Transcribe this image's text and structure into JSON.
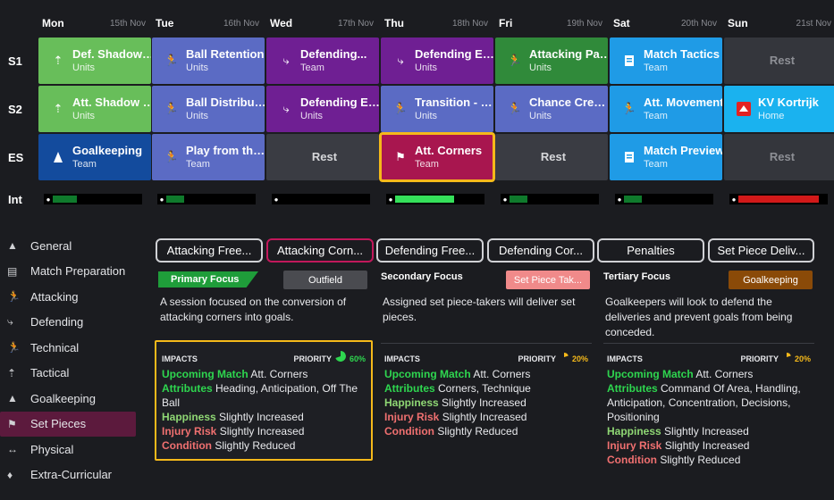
{
  "days": [
    {
      "name": "Mon",
      "date": "15th Nov"
    },
    {
      "name": "Tue",
      "date": "16th Nov"
    },
    {
      "name": "Wed",
      "date": "17th Nov"
    },
    {
      "name": "Thu",
      "date": "18th Nov"
    },
    {
      "name": "Fri",
      "date": "19th Nov"
    },
    {
      "name": "Sat",
      "date": "20th Nov"
    },
    {
      "name": "Sun",
      "date": "21st Nov"
    }
  ],
  "rows": [
    {
      "label": "S1",
      "cells": [
        {
          "title": "Def. Shadow Play",
          "sub": "Units",
          "color": "#68be5a",
          "icon": "tactical-icon"
        },
        {
          "title": "Ball Retention",
          "sub": "Units",
          "color": "#5b6bc4",
          "icon": "technical-icon"
        },
        {
          "title": "Defending...",
          "sub": "Team",
          "color": "#6f1f93",
          "icon": "defending-icon"
        },
        {
          "title": "Defending Engaged",
          "sub": "Units",
          "color": "#6f1f93",
          "icon": "defending-icon"
        },
        {
          "title": "Attacking Patient",
          "sub": "Units",
          "color": "#308a3a",
          "icon": "attacking-icon"
        },
        {
          "title": "Match Tactics",
          "sub": "Team",
          "color": "#1f9be6",
          "icon": "match-prep-icon"
        },
        {
          "title": "Rest",
          "sub": "",
          "color": "#34363c",
          "icon": ""
        }
      ]
    },
    {
      "label": "S2",
      "cells": [
        {
          "title": "Att. Shadow Play",
          "sub": "Units",
          "color": "#68be5a",
          "icon": "tactical-icon"
        },
        {
          "title": "Ball Distribution",
          "sub": "Units",
          "color": "#5b6bc4",
          "icon": "technical-icon"
        },
        {
          "title": "Defending Engaged",
          "sub": "Units",
          "color": "#6f1f93",
          "icon": "defending-icon"
        },
        {
          "title": "Transition - Press",
          "sub": "Units",
          "color": "#5b6bc4",
          "icon": "technical-icon"
        },
        {
          "title": "Chance Creation",
          "sub": "Units",
          "color": "#5b6bc4",
          "icon": "attacking-icon"
        },
        {
          "title": "Att. Movement",
          "sub": "Team",
          "color": "#1f9be6",
          "icon": "attacking-icon"
        },
        {
          "title": "KV Kortrijk",
          "sub": "Home",
          "color": "#1ab2ef",
          "icon": "club-badge-icon"
        }
      ]
    },
    {
      "label": "ES",
      "cells": [
        {
          "title": "Goalkeeping",
          "sub": "Team",
          "color": "#134b9d",
          "icon": "goalkeeping-icon"
        },
        {
          "title": "Play from the Back",
          "sub": "Team",
          "color": "#5b6bc4",
          "icon": "technical-icon"
        },
        {
          "title": "Rest",
          "sub": "",
          "color": "#3a3c43",
          "icon": ""
        },
        {
          "title": "Att. Corners",
          "sub": "Team",
          "color": "#a8164f",
          "icon": "set-pieces-icon"
        },
        {
          "title": "Rest",
          "sub": "",
          "color": "#3a3c43",
          "icon": ""
        },
        {
          "title": "Match Preview",
          "sub": "Team",
          "color": "#1f9be6",
          "icon": "match-prep-icon"
        },
        {
          "title": "Rest",
          "sub": "",
          "color": "#34363c",
          "icon": ""
        }
      ]
    }
  ],
  "intensity": {
    "label": "Int",
    "levels": [
      0.27,
      0.2,
      0,
      0.66,
      0.2,
      0.2,
      0.9
    ],
    "colors": [
      "#0f7a2c",
      "#0f7a2c",
      "#0f7a2c",
      "#35e05a",
      "#0f7a2c",
      "#0f7a2c",
      "#d21919"
    ]
  },
  "sidebar": [
    {
      "label": "General",
      "icon": "general-icon"
    },
    {
      "label": "Match Preparation",
      "icon": "match-prep-icon"
    },
    {
      "label": "Attacking",
      "icon": "attacking-icon"
    },
    {
      "label": "Defending",
      "icon": "defending-icon"
    },
    {
      "label": "Technical",
      "icon": "technical-icon"
    },
    {
      "label": "Tactical",
      "icon": "tactical-icon"
    },
    {
      "label": "Goalkeeping",
      "icon": "goalkeeping-icon"
    },
    {
      "label": "Set Pieces",
      "icon": "set-pieces-icon",
      "active": true
    },
    {
      "label": "Physical",
      "icon": "physical-icon"
    },
    {
      "label": "Extra-Curricular",
      "icon": "extra-curricular-icon"
    }
  ],
  "tabs": [
    "Attacking Free...",
    "Attacking Corn...",
    "Defending Free...",
    "Defending Cor...",
    "Penalties",
    "Set Piece Deliv..."
  ],
  "focus": [
    {
      "title": "Primary Focus",
      "tag": "Outfield",
      "tag_color": "#4a4b50",
      "desc": "A session focused on the conversion of attacking corners into goals.",
      "impacts_label": "IMPACTS",
      "priority_label": "PRIORITY",
      "priority": "60%",
      "upcoming_label": "Upcoming Match",
      "upcoming": "Att. Corners",
      "attributes_label": "Attributes",
      "attributes": "Heading, Anticipation, Off The Ball",
      "happiness_label": "Happiness",
      "happiness": "Slightly Increased",
      "injury_label": "Injury Risk",
      "injury": "Slightly Increased",
      "condition_label": "Condition",
      "condition": "Slightly Reduced"
    },
    {
      "title": "Secondary Focus",
      "tag": "Set Piece Tak...",
      "tag_color": "#f08a8a",
      "desc": "Assigned set piece-takers will deliver set pieces.",
      "impacts_label": "IMPACTS",
      "priority_label": "PRIORITY",
      "priority": "20%",
      "upcoming_label": "Upcoming Match",
      "upcoming": "Att. Corners",
      "attributes_label": "Attributes",
      "attributes": "Corners, Technique",
      "happiness_label": "Happiness",
      "happiness": "Slightly Increased",
      "injury_label": "Injury Risk",
      "injury": "Slightly Increased",
      "condition_label": "Condition",
      "condition": "Slightly Reduced"
    },
    {
      "title": "Tertiary Focus",
      "tag": "Goalkeeping",
      "tag_color": "#8a4a08",
      "desc": "Goalkeepers will look to defend the deliveries and prevent goals from being conceded.",
      "impacts_label": "IMPACTS",
      "priority_label": "PRIORITY",
      "priority": "20%",
      "upcoming_label": "Upcoming Match",
      "upcoming": "Att. Corners",
      "attributes_label": "Attributes",
      "attributes": "Command Of Area, Handling, Anticipation, Concentration, Decisions, Positioning",
      "happiness_label": "Happiness",
      "happiness": "Slightly Increased",
      "injury_label": "Injury Risk",
      "injury": "Slightly Increased",
      "condition_label": "Condition",
      "condition": "Slightly Reduced"
    }
  ]
}
